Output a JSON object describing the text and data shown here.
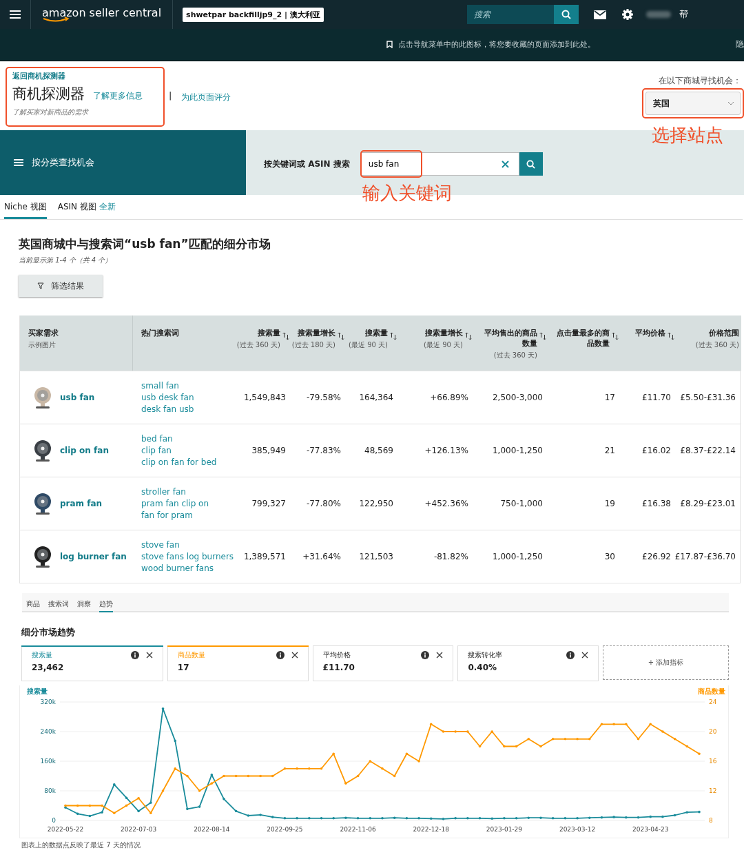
{
  "top_nav": {
    "logo": "amazon seller central",
    "store": "shwetpar backfilljp9_2 | 澳大利亚",
    "search": {
      "placeholder": "搜索"
    },
    "help": "帮"
  },
  "bookmark_bar": {
    "hint": "点击导航菜单中的此图标，将您要收藏的页面添加到此处。",
    "hide": "隐"
  },
  "header": {
    "back_link": "返回商机探测器",
    "title": "商机探测器",
    "learn_more": "了解更多信息",
    "separator": "|",
    "rate_link": "为此页面评分",
    "subtitle": "了解买家对新商品的需求",
    "marketplace_label": "在以下商城寻找机会：",
    "marketplace": {
      "value": "英国"
    },
    "annotation": "选择站点"
  },
  "search_band": {
    "category_button": "按分类查找机会",
    "search_label": "按关键词或 ASIN 搜索",
    "search": {
      "value": "usb fan"
    },
    "annotation": "输入关键词"
  },
  "view_tabs": [
    {
      "label": "Niche 视图",
      "selected": true
    },
    {
      "label": "ASIN 视图",
      "selected": false,
      "badge": "全新"
    }
  ],
  "results": {
    "title": "英国商城中与搜索词“usb fan”匹配的细分市场",
    "count": "当前显示第 1-4 个（共 4 个）",
    "filter_button": "筛选结果"
  },
  "table": {
    "columns": [
      {
        "title": "买家需求",
        "subtitle": "示例图片",
        "sortable": false
      },
      {
        "title": "热门搜索词",
        "sortable": false
      },
      {
        "title": "搜索量",
        "subtitle": "(过去 360 天)",
        "sortable": true
      },
      {
        "title": "搜索量增长",
        "subtitle": "(过去 180 天)",
        "sortable": true
      },
      {
        "title": "搜索量",
        "subtitle": "(最近 90 天)",
        "sortable": true
      },
      {
        "title": "搜索量增长",
        "subtitle": "(最近 90 天)",
        "sortable": true
      },
      {
        "title": "平均售出的商品数量",
        "subtitle": "(过去 360 天)",
        "sortable": true
      },
      {
        "title": "点击量最多的商品数量",
        "sortable": true
      },
      {
        "title": "平均价格",
        "sortable": true
      },
      {
        "title": "价格范围",
        "subtitle": "(过去 360 天)",
        "sortable": false
      }
    ],
    "rows": [
      {
        "cells": [
          "usb fan",
          [
            "small fan",
            "usb desk fan",
            "desk fan usb"
          ],
          "1,549,843",
          "-79.58%",
          "164,364",
          "+66.89%",
          "2,500-3,000",
          "17",
          "£11.70",
          "£5.50-£31.36"
        ]
      },
      {
        "cells": [
          "clip on fan",
          [
            "bed fan",
            "clip fan",
            "clip on fan for bed"
          ],
          "385,949",
          "-77.83%",
          "48,569",
          "+126.13%",
          "1,000-1,250",
          "21",
          "£16.02",
          "£8.37-£22.14"
        ]
      },
      {
        "cells": [
          "pram fan",
          [
            "stroller fan",
            "pram fan clip on",
            "fan for pram"
          ],
          "799,327",
          "-77.80%",
          "122,950",
          "+452.36%",
          "750-1,000",
          "19",
          "£16.38",
          "£8.29-£23.01"
        ]
      },
      {
        "cells": [
          "log burner fan",
          [
            "stove fan",
            "stove fans log burners",
            "wood burner fans"
          ],
          "1,389,571",
          "+31.64%",
          "121,503",
          "-81.82%",
          "1,000-1,250",
          "30",
          "£26.92",
          "£17.87-£36.70"
        ]
      }
    ]
  },
  "detail_tabs": [
    {
      "label": "商品",
      "selected": false
    },
    {
      "label": "搜索词",
      "selected": false
    },
    {
      "label": "洞察",
      "selected": false
    },
    {
      "label": "趋势",
      "selected": true
    }
  ],
  "trend": {
    "title": "细分市场趋势",
    "metrics": [
      {
        "label": "搜索量",
        "value": "23,462",
        "color": "#1a8c9b"
      },
      {
        "label": "商品数量",
        "value": "17",
        "color": "#ff9900"
      },
      {
        "label": "平均价格",
        "value": "£11.70"
      },
      {
        "label": "搜索转化率",
        "value": "0.40%"
      }
    ],
    "add_metric": "+ 添加指标",
    "chart_data": {
      "type": "line",
      "grid": true,
      "ylim": [
        0,
        320000
      ],
      "y2lim": [
        8,
        24
      ],
      "yticks": [
        {
          "value": 0,
          "label": "0"
        },
        {
          "value": 80000,
          "label": "80k"
        },
        {
          "value": 160000,
          "label": "160k"
        },
        {
          "value": 240000,
          "label": "240k"
        },
        {
          "value": 320000,
          "label": "320k"
        }
      ],
      "y2ticks": [
        8,
        12,
        16,
        20,
        24
      ],
      "categories": [
        "2022-05-22",
        null,
        null,
        null,
        null,
        null,
        "2022-07-03",
        null,
        null,
        null,
        null,
        null,
        "2022-08-14",
        null,
        null,
        null,
        null,
        null,
        "2022-09-25",
        null,
        null,
        null,
        null,
        null,
        "2022-11-06",
        null,
        null,
        null,
        null,
        null,
        "2022-12-18",
        null,
        null,
        null,
        null,
        null,
        "2023-01-29",
        null,
        null,
        null,
        null,
        null,
        "2023-03-12",
        null,
        null,
        null,
        null,
        null,
        "2023-04-23",
        null,
        null,
        null,
        null
      ],
      "series": [
        {
          "name": "搜索量",
          "color": "#1a8c9b",
          "values": [
            35000,
            18000,
            12000,
            22000,
            97000,
            61000,
            25000,
            48000,
            302000,
            215000,
            31000,
            37000,
            123000,
            58000,
            25000,
            13000,
            15000,
            9000,
            6000,
            6000,
            6000,
            6000,
            6000,
            7000,
            6000,
            6000,
            6000,
            7000,
            6000,
            6000,
            5000,
            4000,
            6000,
            6000,
            6000,
            5000,
            6000,
            6000,
            7000,
            7000,
            6000,
            6000,
            6000,
            7000,
            8000,
            9000,
            8000,
            8000,
            10000,
            10000,
            14000,
            22000,
            23000
          ]
        },
        {
          "name": "商品数量",
          "color": "#ff9900",
          "axis": "y2",
          "values": [
            10,
            10,
            10,
            10,
            9,
            10,
            11,
            9,
            12,
            15,
            14,
            12,
            13,
            14,
            14,
            14,
            14,
            14,
            15,
            15,
            15,
            15,
            17,
            13,
            14,
            16,
            15,
            14,
            17,
            16,
            21,
            20,
            20,
            20,
            18,
            20,
            18,
            18,
            19,
            18,
            19,
            19,
            19,
            19,
            21,
            21,
            21,
            19,
            21,
            20,
            19,
            18,
            17
          ]
        }
      ]
    },
    "note": "图表上的数据点反映了最近 7 天的情况"
  }
}
